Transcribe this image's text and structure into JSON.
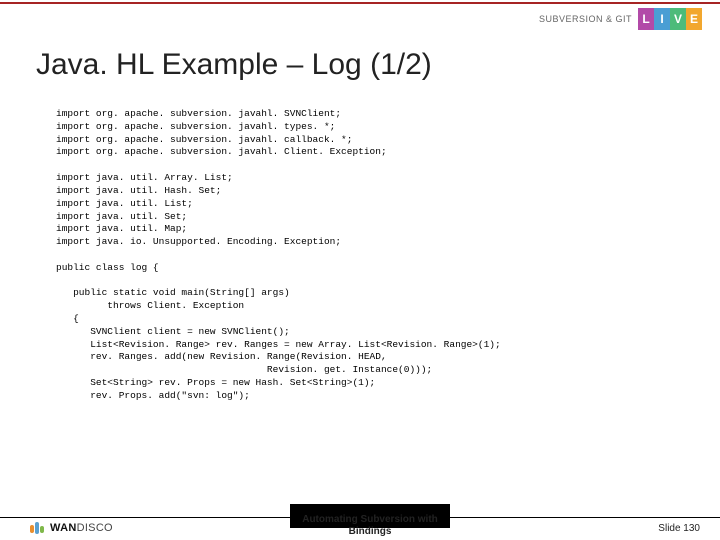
{
  "brand_text": "SUBVERSION & GIT",
  "live": [
    "L",
    "I",
    "V",
    "E"
  ],
  "title": "Java. HL Example – Log (1/2)",
  "code": "import org. apache. subversion. javahl. SVNClient;\nimport org. apache. subversion. javahl. types. *;\nimport org. apache. subversion. javahl. callback. *;\nimport org. apache. subversion. javahl. Client. Exception;\n\nimport java. util. Array. List;\nimport java. util. Hash. Set;\nimport java. util. List;\nimport java. util. Set;\nimport java. util. Map;\nimport java. io. Unsupported. Encoding. Exception;\n\npublic class log {\n\n   public static void main(String[] args)\n         throws Client. Exception\n   {\n      SVNClient client = new SVNClient();\n      List<Revision. Range> rev. Ranges = new Array. List<Revision. Range>(1);\n      rev. Ranges. add(new Revision. Range(Revision. HEAD,\n                                     Revision. get. Instance(0)));\n      Set<String> rev. Props = new Hash. Set<String>(1);\n      rev. Props. add(\"svn: log\");",
  "footer_title_line1": "Automating Subversion with",
  "footer_title_line2": "Bindings",
  "wandisco_bold": "WAN",
  "wandisco_light": "DISCO",
  "slide_label": "Slide 130"
}
